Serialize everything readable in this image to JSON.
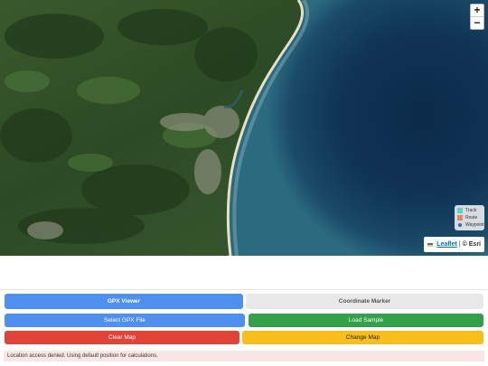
{
  "map": {
    "zoom_in_label": "+",
    "zoom_out_label": "−",
    "legend": [
      {
        "label": "Track",
        "color": "#5fd0c6",
        "icon": "square"
      },
      {
        "label": "Route",
        "color": "#e8806a",
        "icon": "square"
      },
      {
        "label": "Waypoint",
        "color": "#3a63c9",
        "icon": "circle"
      }
    ],
    "attribution": {
      "flag_icon": "ukraine-flag-icon",
      "link_label": "Leaflet",
      "separator": "|",
      "credit": "© Esri"
    }
  },
  "tabs": [
    {
      "label": "GPX Viewer",
      "active": true,
      "color": "#4f8ff0"
    },
    {
      "label": "Coordinate Marker",
      "active": false,
      "color": "#e8e8e8"
    }
  ],
  "actions": {
    "select_gpx": "Select GPX File",
    "load_sample": "Load Sample",
    "clear_map": "Clear Map",
    "change_map": "Change Map"
  },
  "status": "Location access denied. Using default position for calculations."
}
